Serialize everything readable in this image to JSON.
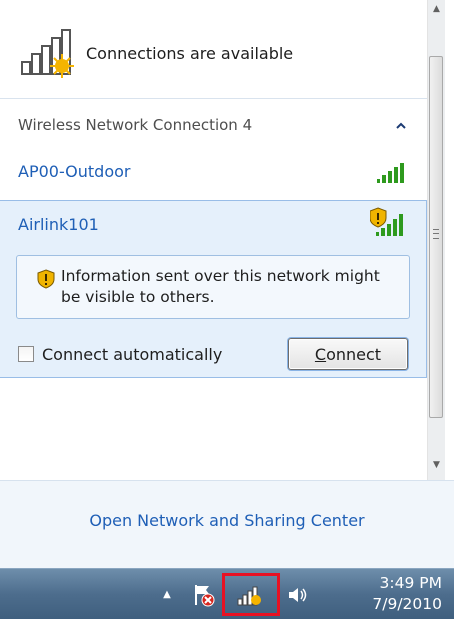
{
  "header": {
    "title": "Connections are available",
    "icon": "network-available-icon"
  },
  "section": {
    "title": "Wireless Network Connection 4",
    "collapse_icon": "chevron-up-icon"
  },
  "networks": [
    {
      "name": "AP00-Outdoor",
      "signal_bars": 5,
      "secured": true,
      "icon": "signal-strength-icon"
    },
    {
      "name": "Airlink101",
      "signal_bars": 5,
      "secured": false,
      "icon": "unsecured-signal-icon"
    }
  ],
  "selected_network": {
    "info_text": "Information sent over this network might be visible to others.",
    "connect_auto_label": "Connect automatically",
    "connect_auto_checked": false,
    "connect_button_label": "Connect"
  },
  "footer": {
    "link": "Open Network and Sharing Center"
  },
  "taskbar": {
    "time": "3:49 PM",
    "date": "7/9/2010",
    "icons": [
      "show-hidden-icons-arrow",
      "action-center-flag-icon",
      "network-tray-icon",
      "volume-icon"
    ],
    "highlight_color": "#e81123"
  },
  "colors": {
    "link": "#1f5fb6",
    "selection_bg": "#e5f0fb",
    "taskbar": "#4d6d8d"
  }
}
